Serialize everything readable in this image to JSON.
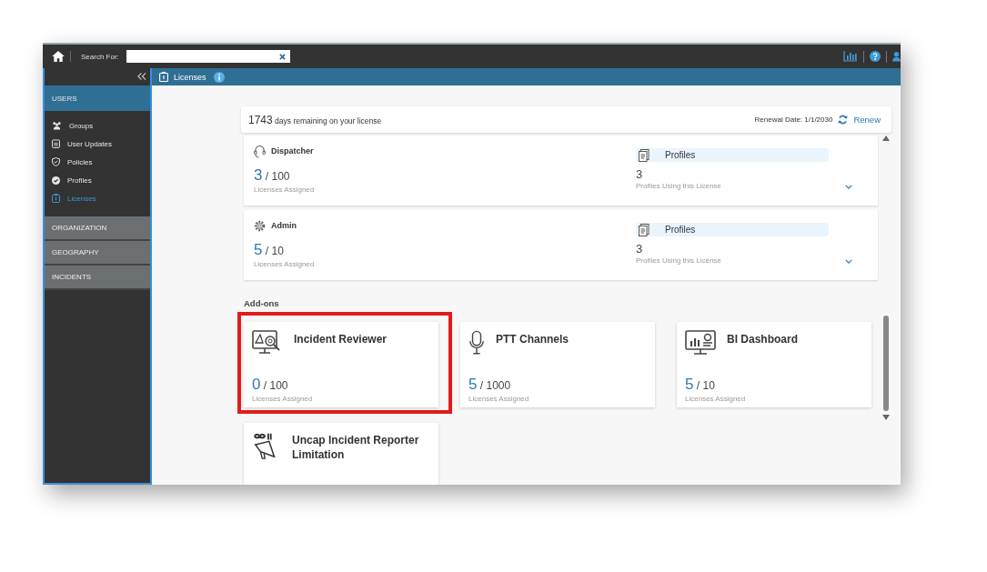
{
  "topbar": {
    "search_label": "Search For:"
  },
  "breadcrumb": {
    "title": "Licenses"
  },
  "sidebar": {
    "sections": [
      {
        "label": "USERS",
        "expanded": true,
        "items": [
          {
            "kind": "groups",
            "label": "Groups",
            "selected": false
          },
          {
            "kind": "updates",
            "label": "User Updates",
            "selected": false
          },
          {
            "kind": "policies",
            "label": "Policies",
            "selected": false
          },
          {
            "kind": "profiles",
            "label": "Profiles",
            "selected": false
          },
          {
            "kind": "licenses",
            "label": "Licenses",
            "selected": true
          }
        ]
      },
      {
        "label": "ORGANIZATION",
        "expanded": false
      },
      {
        "label": "GEOGRAPHY",
        "expanded": false
      },
      {
        "label": "INCIDENTS",
        "expanded": false
      }
    ]
  },
  "license_summary": {
    "days": "1743",
    "days_text": "days remaining on your license",
    "renewal": "Renewal Date: 1/1/2030",
    "renew": "Renew"
  },
  "licenses": [
    {
      "kind": "headset",
      "name": "Dispatcher",
      "assigned": "3",
      "total": "/ 100",
      "caption": "Licenses Assigned",
      "profiles_label": "Profiles",
      "profiles_count": "3",
      "profiles_caption": "Profiles Using this License"
    },
    {
      "kind": "gear",
      "name": "Admin",
      "assigned": "5",
      "total": "/ 10",
      "caption": "Licenses Assigned",
      "profiles_label": "Profiles",
      "profiles_count": "3",
      "profiles_caption": "Profiles Using this License"
    }
  ],
  "addons_title": "Add-ons",
  "addons": [
    {
      "kind": "reviewer",
      "name": "Incident Reviewer",
      "assigned": "0",
      "total": "/ 100",
      "caption": "Licenses Assigned",
      "highlighted": true
    },
    {
      "kind": "microphone",
      "name": "PTT Channels",
      "assigned": "5",
      "total": "/ 1000",
      "caption": "Licenses Assigned",
      "highlighted": false
    },
    {
      "kind": "dashboard",
      "name": "BI Dashboard",
      "assigned": "5",
      "total": "/ 10",
      "caption": "Licenses Assigned",
      "highlighted": false
    },
    {
      "kind": "megaphone",
      "name": "Uncap Incident Reporter Limitation",
      "highlighted": false
    }
  ]
}
